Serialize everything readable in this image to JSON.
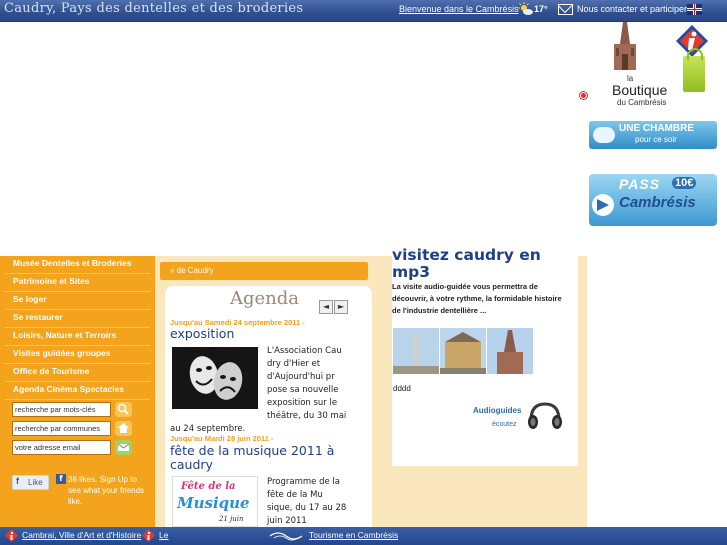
{
  "topbar": {
    "title": "Caudry, Pays des dentelles et des broderies",
    "welcome_link": "Bienvenue dans le Cambrésis",
    "temperature": "17°",
    "contact_link": "Nous contacter et participer",
    "icons": [
      "weather-sun-cloud-icon",
      "mail-icon",
      "uk-flag-icon"
    ]
  },
  "boutique": {
    "la": "la",
    "title": "Boutique",
    "subtitle": "du Cambrésis"
  },
  "banners": {
    "chambre_main": "UNE CHAMBRE",
    "chambre_sub": "pour ce soir",
    "pass_word": "PASS",
    "pass_price": "10€",
    "pass_place": "Cambrésis"
  },
  "nav": {
    "items": [
      "Musée Dentelles et Broderies",
      "Patrimoine et Sites",
      "Se loger",
      "Se restaurer",
      "Loisirs, Nature et Terroirs",
      "Visites guidées groupes",
      "Office de Tourisme",
      "Agenda Cinéma Spectacles"
    ],
    "search_keywords": "recherche par mots-clés",
    "search_communes": "recherche par communes",
    "email": "votre adresse email"
  },
  "facebook": {
    "like_label": "Like",
    "text": "38 likes. Sign Up to see what your friends like."
  },
  "breadcrumb": "» de Caudry",
  "agenda": {
    "title": "Agenda",
    "prev": "◄",
    "next": "►",
    "events": [
      {
        "date": "Jusqu'au Samedi 24 septembre 2011 -",
        "title": "exposition",
        "text_lines": [
          "L'Association Cau",
          "dry d'Hier et",
          "d'Aujourd'hui pr",
          "pose sa nouvelle",
          "exposition sur le",
          "théâtre, du 30 mai"
        ],
        "text_tail": "au 24 septembre."
      },
      {
        "date": "Jusqu'au Mardi 28 juin 2011 -",
        "title_line1": "fête de la musique 2011 à",
        "title_line2": "caudry",
        "text_lines": [
          "Programme de la",
          "fête de la Mu",
          "sique, du 17 au 28",
          "juin 2011"
        ]
      }
    ],
    "musique_img_line1": "Fête de la",
    "musique_img_line2": "Musique",
    "musique_img_date": "21 juin"
  },
  "audio": {
    "title": "visitez caudry en mp3",
    "description": "La visite audio-guidée vous permettra de découvrir, à votre rythme, la formidable histoire de l'industrie dentellière ...",
    "ddd": "dddd",
    "audioguides": "Audioguides",
    "ecoutez": "écoutez"
  },
  "bottom": {
    "link1": "Cambrai, Ville d'Art et d'Histoire",
    "link2": "Le",
    "link3": "Tourisme en Cambrésis"
  },
  "colors": {
    "topbar": "#2f4f90",
    "nav_orange": "#f4a31c",
    "agenda_date": "#f0a01a",
    "title_blue": "#1f3f86"
  }
}
